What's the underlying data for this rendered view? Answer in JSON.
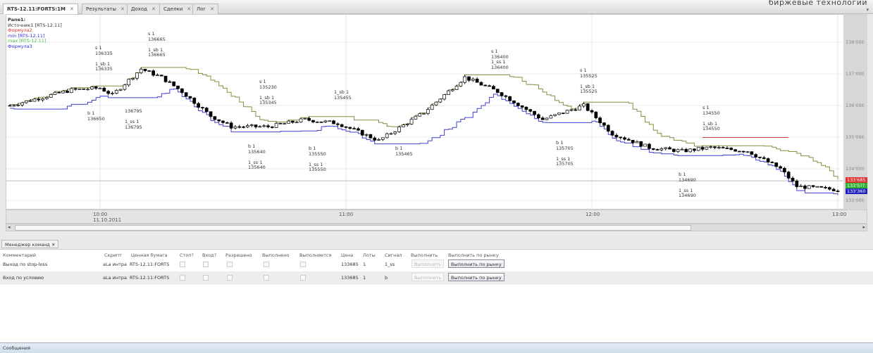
{
  "brand": "биржевые технологии",
  "tabs": [
    {
      "label": "RTS-12.11:FORTS:1M"
    },
    {
      "label": "Результаты"
    },
    {
      "label": "Доход"
    },
    {
      "label": "Сделки"
    },
    {
      "label": "Лог"
    }
  ],
  "legend": {
    "pane": "Pane1:",
    "items": [
      {
        "label": "Источник1 [RTS-12.11]",
        "color": "#333333"
      },
      {
        "label": "Формула2",
        "color": "#e03030"
      },
      {
        "label": "min [RTS-12.11]",
        "color": "#3030d0"
      },
      {
        "label": "max [RTS-12.11]",
        "color": "#40c040"
      },
      {
        "label": "Формула3",
        "color": "#3030d0"
      }
    ]
  },
  "price_axis": [
    "138'000",
    "137'000",
    "136'000",
    "135'000",
    "134'000",
    "133'000"
  ],
  "price_tags": [
    {
      "label": "133'685",
      "color": "#e03030"
    },
    {
      "label": "133'5??",
      "color": "#30b030"
    },
    {
      "label": "133'360",
      "color": "#2020c0"
    }
  ],
  "time_axis": [
    {
      "label": "10:00",
      "sub": "11.10.2011"
    },
    {
      "label": "11:00",
      "sub": ""
    },
    {
      "label": "12:00",
      "sub": ""
    },
    {
      "label": "13:00",
      "sub": ""
    }
  ],
  "chart_data": {
    "type": "candlestick",
    "symbol": "RTS-12.11",
    "timeframe": "1M",
    "ylim": [
      132800,
      138500
    ],
    "x_unit": "minutes from 10:00",
    "path": [
      [
        -22,
        136000
      ],
      [
        -7,
        136490
      ],
      [
        0,
        136555
      ],
      [
        3,
        136330
      ],
      [
        10,
        137155
      ],
      [
        15,
        136890
      ],
      [
        20,
        136440
      ],
      [
        27,
        135670
      ],
      [
        32,
        135330
      ],
      [
        41,
        135330
      ],
      [
        50,
        135555
      ],
      [
        58,
        135440
      ],
      [
        68,
        134890
      ],
      [
        79,
        135780
      ],
      [
        89,
        136890
      ],
      [
        97,
        136440
      ],
      [
        108,
        135555
      ],
      [
        118,
        136000
      ],
      [
        125,
        135110
      ],
      [
        134,
        134670
      ],
      [
        142,
        134560
      ],
      [
        149,
        134670
      ],
      [
        158,
        134560
      ],
      [
        166,
        134000
      ],
      [
        170,
        133445
      ],
      [
        180,
        133335
      ]
    ],
    "formula2_level": 134990,
    "annotations": [
      "s 1\n136335\n\n1_sb 1\n136335",
      "s 1\n136665\n\n1_sb 1\n136665",
      "b 1\n136650",
      "136795\n\n1_ss 1\n136795",
      "s 1\n135230\n\n1_sb 1\n135345",
      "1_sb 1\n135455",
      "b 1\n135640\n\n1_ss 1\n135640",
      "b 1\n135550\n\n1_ss 1\n135550",
      "b 1\n135465",
      "s 1\n136400\n1_ss 1\n136400",
      "s 1\n135525\n\n1_sb 1\n135525",
      "b 1\n135705\n\n1_ss 1\n135705",
      "s 1\n134550\n\n1_sb 1\n134550",
      "b 1\n134690\n\n1_ss 1\n134690"
    ]
  },
  "command_manager": {
    "tab": "Менеджер команд",
    "columns": [
      "Комментарий",
      "Скрипт",
      "Ценная бумага",
      "Стоп?",
      "Вход?",
      "Разрешено",
      "Выполнено",
      "Выполняется",
      "Цена",
      "Лоты",
      "Сигнал",
      "Выполнить",
      "Выполнить по рынку"
    ],
    "rows": [
      {
        "comment": "Выход по stop-loss",
        "script": "aLa интра",
        "security": "RTS-12.11:FORTS",
        "price": "133685",
        "lots": "1",
        "signal": "1_ss",
        "exec": "Выполнить",
        "exec_market": "Выполнить по рынку"
      },
      {
        "comment": "Вход по условию",
        "script": "aLa интра",
        "security": "RTS-12.11:FORTS",
        "price": "133685",
        "lots": "1",
        "signal": "b",
        "exec": "Выполнить",
        "exec_market": "Выполнить по рынку"
      }
    ]
  },
  "messages": {
    "label": "Сообщения"
  }
}
